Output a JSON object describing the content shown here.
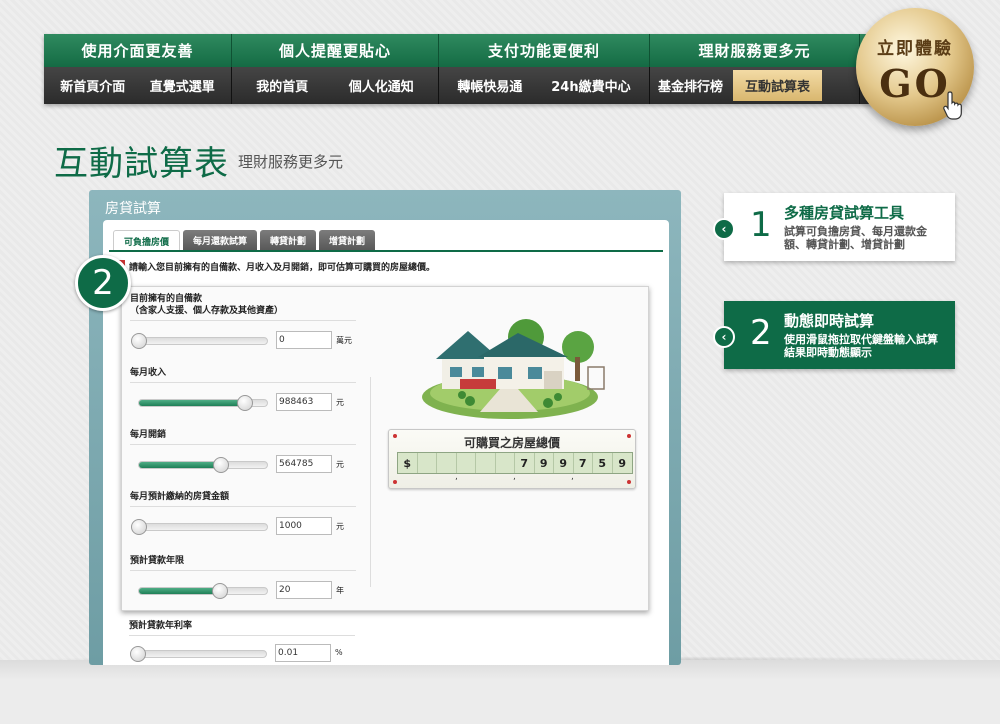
{
  "nav": {
    "categories": [
      "使用介面更友善",
      "個人提醒更貼心",
      "支付功能更便利",
      "理財服務更多元"
    ],
    "groups": [
      [
        "新首頁介面",
        "直覺式選單"
      ],
      [
        "我的首頁",
        "個人化通知"
      ],
      [
        "轉帳快易通",
        "24h繳費中心"
      ],
      [
        "基金排行榜",
        "互動試算表"
      ]
    ],
    "active_item": "互動試算表"
  },
  "go_badge": {
    "top": "立即體驗",
    "big": "GO",
    "cursor_icon": "hand-pointer-icon"
  },
  "header": {
    "title": "互動試算表",
    "subtitle": "理財服務更多元"
  },
  "calculator": {
    "title": "房貸試算",
    "tabs": [
      "可負擔房價",
      "每月還款試算",
      "轉貸計劃",
      "增貸計劃"
    ],
    "active_tab": "可負擔房價",
    "instruction": "請輸入您目前擁有的自備款、月收入及月開銷，即可估算可購買的房屋總價。",
    "badge_number": "2",
    "fields": [
      {
        "label": "目前擁有的自備款",
        "sublabel": "（含家人支援、個人存款及其他資產）",
        "value": "0",
        "unit": "萬元",
        "slider": 0
      },
      {
        "label": "每月收入",
        "sublabel": "",
        "value": "988463",
        "unit": "元",
        "slider": 0.83
      },
      {
        "label": "每月開銷",
        "sublabel": "",
        "value": "564785",
        "unit": "元",
        "slider": 0.64
      },
      {
        "label": "每月預計繳納的房貸金額",
        "sublabel": "",
        "value": "1000",
        "unit": "元",
        "slider": 0
      },
      {
        "label": "預計貸款年限",
        "sublabel": "",
        "value": "20",
        "unit": "年",
        "slider": 0.63
      },
      {
        "label": "預計貸款年利率",
        "sublabel": "",
        "value": "0.01",
        "unit": "%",
        "slider": 0
      }
    ],
    "result": {
      "title": "可購買之房屋總價",
      "currency": "$",
      "digits": [
        "",
        "",
        "",
        "",
        "",
        "",
        "7",
        "9",
        "9",
        "7",
        "5",
        "9"
      ],
      "separators": [
        ",",
        ",",
        ","
      ]
    }
  },
  "features": [
    {
      "number": "1",
      "title": "多種房貸試算工具",
      "desc": "試算可負擔房貸、每月還款金額、轉貸計劃、增貸計劃",
      "arrow_icon": "chevron-left-icon"
    },
    {
      "number": "2",
      "title": "動態即時試算",
      "desc": "使用滑鼠拖拉取代鍵盤輸入試算結果即時動態顯示",
      "arrow_icon": "chevron-left-icon"
    }
  ]
}
